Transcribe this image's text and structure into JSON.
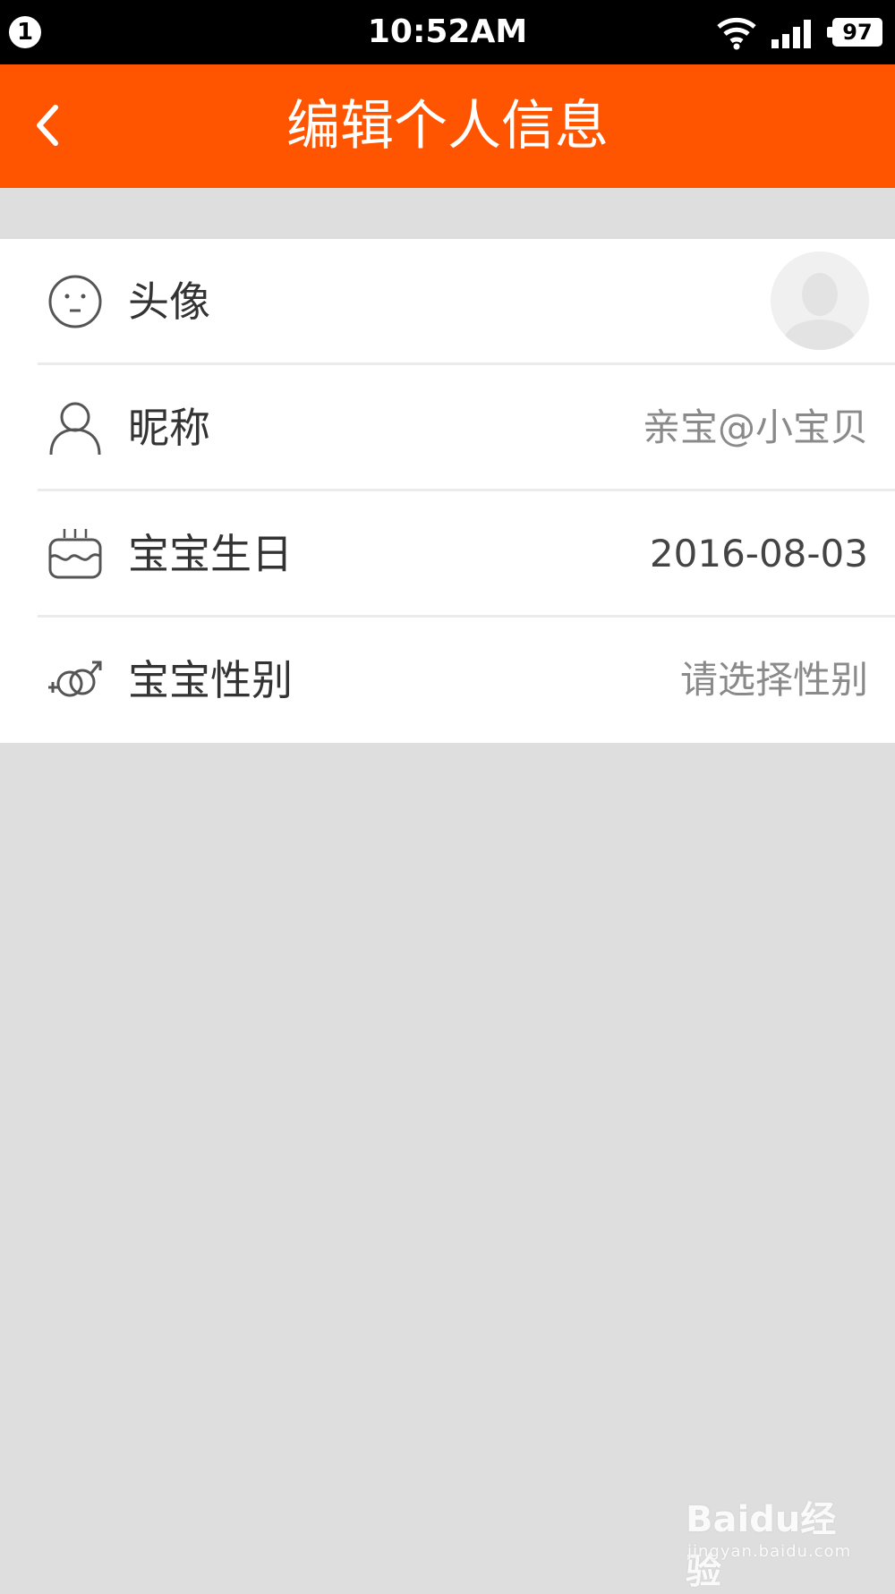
{
  "status_bar": {
    "notification_count": "1",
    "time": "10:52AM",
    "battery": "97",
    "icons": [
      "wifi-icon",
      "signal-icon",
      "battery-icon"
    ]
  },
  "header": {
    "title": "编辑个人信息",
    "back_icon": "chevron-left-icon"
  },
  "profile_rows": [
    {
      "icon": "face-icon",
      "label": "头像",
      "value": ""
    },
    {
      "icon": "person-icon",
      "label": "昵称",
      "value": "亲宝@小宝贝"
    },
    {
      "icon": "cake-icon",
      "label": "宝宝生日",
      "value": "2016-08-03"
    },
    {
      "icon": "gender-icon",
      "label": "宝宝性别",
      "value": "请选择性别"
    }
  ],
  "watermark": {
    "brand": "Baidu经验",
    "url": "jingyan.baidu.com"
  },
  "colors": {
    "accent": "#ff5400",
    "background": "#dedede",
    "value_muted": "#8a8a8a",
    "value_dark": "#444444"
  }
}
